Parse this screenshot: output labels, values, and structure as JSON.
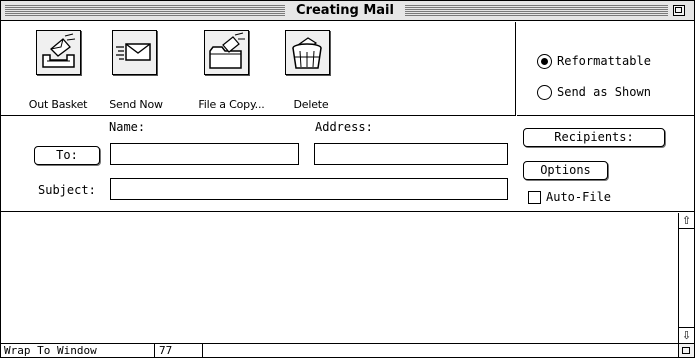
{
  "window": {
    "title": "Creating Mail"
  },
  "toolbar": {
    "buttons": [
      {
        "label": "Out Basket",
        "icon": "out-basket-icon"
      },
      {
        "label": "Send Now",
        "icon": "send-envelope-icon"
      },
      {
        "label": "File a Copy...",
        "icon": "file-folder-icon"
      },
      {
        "label": "Delete",
        "icon": "trash-basket-icon"
      }
    ]
  },
  "format": {
    "options": [
      {
        "label": "Reformattable",
        "selected": true
      },
      {
        "label": "Send as Shown",
        "selected": false
      }
    ]
  },
  "fields": {
    "name_label": "Name:",
    "address_label": "Address:",
    "to_label": "To:",
    "subject_label": "Subject:",
    "name_value": "",
    "address_value": "",
    "subject_value": ""
  },
  "side_buttons": {
    "recipients": "Recipients:",
    "options": "Options",
    "auto_file": "Auto-File",
    "auto_file_checked": false
  },
  "body": {
    "text": ""
  },
  "status": {
    "wrap": "Wrap To Window",
    "column": "77"
  }
}
